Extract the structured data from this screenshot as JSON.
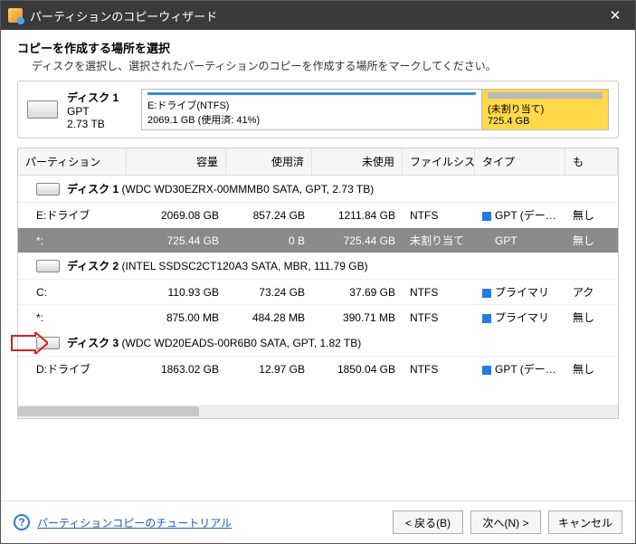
{
  "window": {
    "title": "パーティションのコピーウィザード"
  },
  "header": {
    "title": "コピーを作成する場所を選択",
    "subtitle": "ディスクを選択し、選択されたパーティションのコピーを作成する場所をマークしてください。"
  },
  "summary": {
    "name": "ディスク 1",
    "scheme": "GPT",
    "size": "2.73 TB",
    "segments": [
      {
        "label": "E:ドライブ(NTFS)",
        "detail": "2069.1 GB (使用済: 41%)",
        "color": "#2f8fd3"
      },
      {
        "label": "(未割り当て)",
        "detail": "725.4 GB",
        "color": "#ffd94a"
      }
    ]
  },
  "grid": {
    "columns": [
      "パーティション",
      "容量",
      "使用済",
      "未使用",
      "ファイルシステム",
      "タイプ",
      "も"
    ],
    "groups": [
      {
        "title_bold": "ディスク 1",
        "title_rest": "(WDC WD30EZRX-00MMMB0 SATA, GPT, 2.73 TB)",
        "rows": [
          {
            "part": "E:ドライブ",
            "cap": "2069.08 GB",
            "used": "857.24 GB",
            "free": "1211.84 GB",
            "fs": "NTFS",
            "type": "GPT (データ…",
            "type_sq": "blue",
            "extra": "無し",
            "selected": false
          },
          {
            "part": "*:",
            "cap": "725.44 GB",
            "used": "0 B",
            "free": "725.44 GB",
            "fs": "未割り当て",
            "type": "GPT",
            "type_sq": "none",
            "extra": "無し",
            "selected": true
          }
        ]
      },
      {
        "title_bold": "ディスク 2",
        "title_rest": "(INTEL SSDSC2CT120A3 SATA, MBR, 111.79 GB)",
        "rows": [
          {
            "part": "C:",
            "cap": "110.93 GB",
            "used": "73.24 GB",
            "free": "37.69 GB",
            "fs": "NTFS",
            "type": "プライマリ",
            "type_sq": "blue",
            "extra": "アク",
            "selected": false
          },
          {
            "part": "*:",
            "cap": "875.00 MB",
            "used": "484.28 MB",
            "free": "390.71 MB",
            "fs": "NTFS",
            "type": "プライマリ",
            "type_sq": "blue",
            "extra": "無し",
            "selected": false
          }
        ]
      },
      {
        "title_bold": "ディスク 3",
        "title_rest": "(WDC WD20EADS-00R6B0 SATA, GPT, 1.82 TB)",
        "rows": [
          {
            "part": "D:ドライブ",
            "cap": "1863.02 GB",
            "used": "12.97 GB",
            "free": "1850.04 GB",
            "fs": "NTFS",
            "type": "GPT (データ…",
            "type_sq": "blue",
            "extra": "無し",
            "selected": false
          }
        ]
      }
    ]
  },
  "footer": {
    "tutorial": "パーティションコピーのチュートリアル",
    "back": "< 戻る(B)",
    "next": "次へ(N) >",
    "cancel": "キャンセル"
  }
}
